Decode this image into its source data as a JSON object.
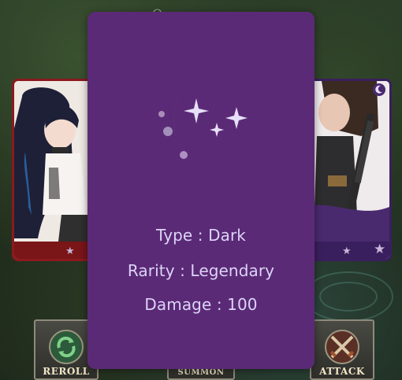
{
  "element": {
    "icon": "crescent-moon-with-sparkles-icon",
    "type_label": "Type",
    "type_value": "Dark",
    "rarity_label": "Rarity",
    "rarity_value": "Legendary",
    "damage_label": "Damage",
    "damage_value": "100",
    "separator": " : "
  },
  "buttons": {
    "reroll_label": "REROLL",
    "summon_label": "SUMMON",
    "attack_label": "ATTACK"
  },
  "colors": {
    "modal_background": "#5b2a76",
    "info_text": "#dcd4f7",
    "left_card_frame": "#8a1a1f",
    "right_card_frame": "#3a1f5e"
  }
}
